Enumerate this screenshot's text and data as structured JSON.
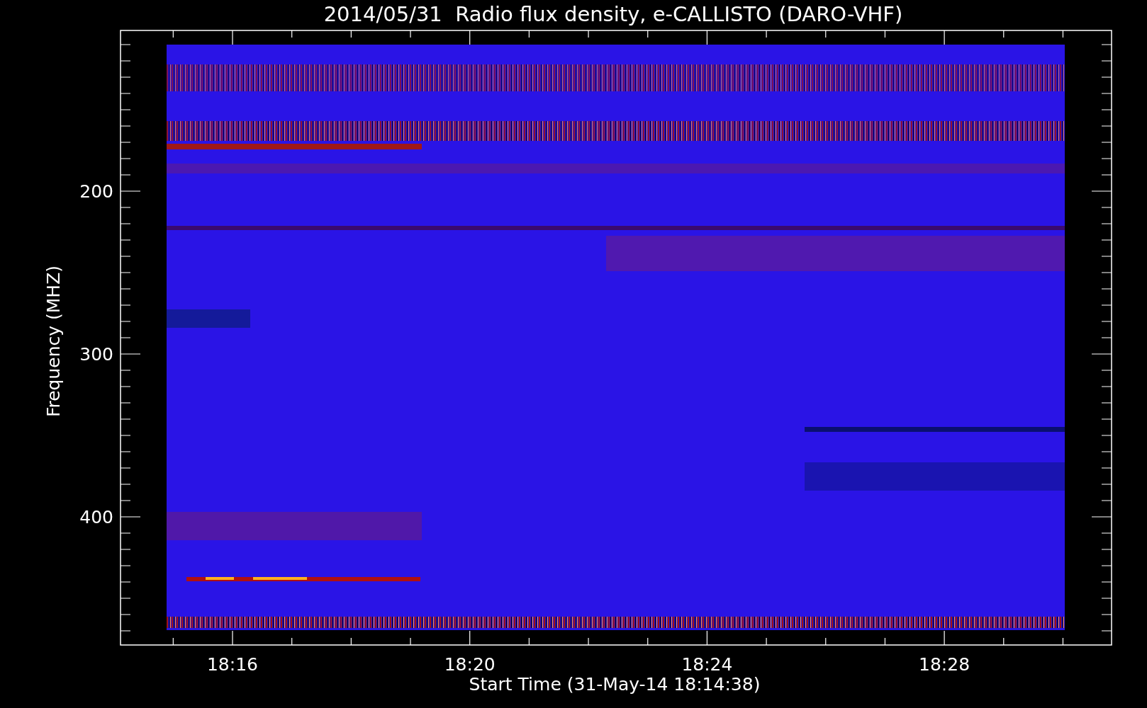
{
  "title": "2014/05/31  Radio flux density, e-CALLISTO (DARO-VHF)",
  "y_axis": {
    "label": "Frequency (MHZ)",
    "ticks": [
      "200",
      "300",
      "400"
    ]
  },
  "x_axis": {
    "label": "Start Time (31-May-14 18:14:38)",
    "ticks": [
      "18:16",
      "18:20",
      "18:24",
      "18:28"
    ]
  }
}
